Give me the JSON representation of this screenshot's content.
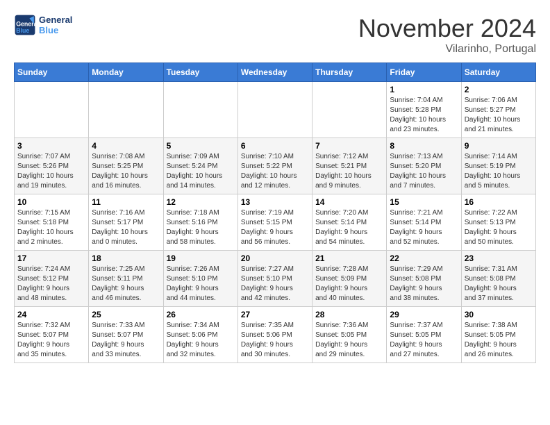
{
  "logo": {
    "general": "General",
    "blue": "Blue"
  },
  "title": "November 2024",
  "location": "Vilarinho, Portugal",
  "weekdays": [
    "Sunday",
    "Monday",
    "Tuesday",
    "Wednesday",
    "Thursday",
    "Friday",
    "Saturday"
  ],
  "weeks": [
    [
      {
        "day": "",
        "info": ""
      },
      {
        "day": "",
        "info": ""
      },
      {
        "day": "",
        "info": ""
      },
      {
        "day": "",
        "info": ""
      },
      {
        "day": "",
        "info": ""
      },
      {
        "day": "1",
        "info": "Sunrise: 7:04 AM\nSunset: 5:28 PM\nDaylight: 10 hours\nand 23 minutes."
      },
      {
        "day": "2",
        "info": "Sunrise: 7:06 AM\nSunset: 5:27 PM\nDaylight: 10 hours\nand 21 minutes."
      }
    ],
    [
      {
        "day": "3",
        "info": "Sunrise: 7:07 AM\nSunset: 5:26 PM\nDaylight: 10 hours\nand 19 minutes."
      },
      {
        "day": "4",
        "info": "Sunrise: 7:08 AM\nSunset: 5:25 PM\nDaylight: 10 hours\nand 16 minutes."
      },
      {
        "day": "5",
        "info": "Sunrise: 7:09 AM\nSunset: 5:24 PM\nDaylight: 10 hours\nand 14 minutes."
      },
      {
        "day": "6",
        "info": "Sunrise: 7:10 AM\nSunset: 5:22 PM\nDaylight: 10 hours\nand 12 minutes."
      },
      {
        "day": "7",
        "info": "Sunrise: 7:12 AM\nSunset: 5:21 PM\nDaylight: 10 hours\nand 9 minutes."
      },
      {
        "day": "8",
        "info": "Sunrise: 7:13 AM\nSunset: 5:20 PM\nDaylight: 10 hours\nand 7 minutes."
      },
      {
        "day": "9",
        "info": "Sunrise: 7:14 AM\nSunset: 5:19 PM\nDaylight: 10 hours\nand 5 minutes."
      }
    ],
    [
      {
        "day": "10",
        "info": "Sunrise: 7:15 AM\nSunset: 5:18 PM\nDaylight: 10 hours\nand 2 minutes."
      },
      {
        "day": "11",
        "info": "Sunrise: 7:16 AM\nSunset: 5:17 PM\nDaylight: 10 hours\nand 0 minutes."
      },
      {
        "day": "12",
        "info": "Sunrise: 7:18 AM\nSunset: 5:16 PM\nDaylight: 9 hours\nand 58 minutes."
      },
      {
        "day": "13",
        "info": "Sunrise: 7:19 AM\nSunset: 5:15 PM\nDaylight: 9 hours\nand 56 minutes."
      },
      {
        "day": "14",
        "info": "Sunrise: 7:20 AM\nSunset: 5:14 PM\nDaylight: 9 hours\nand 54 minutes."
      },
      {
        "day": "15",
        "info": "Sunrise: 7:21 AM\nSunset: 5:14 PM\nDaylight: 9 hours\nand 52 minutes."
      },
      {
        "day": "16",
        "info": "Sunrise: 7:22 AM\nSunset: 5:13 PM\nDaylight: 9 hours\nand 50 minutes."
      }
    ],
    [
      {
        "day": "17",
        "info": "Sunrise: 7:24 AM\nSunset: 5:12 PM\nDaylight: 9 hours\nand 48 minutes."
      },
      {
        "day": "18",
        "info": "Sunrise: 7:25 AM\nSunset: 5:11 PM\nDaylight: 9 hours\nand 46 minutes."
      },
      {
        "day": "19",
        "info": "Sunrise: 7:26 AM\nSunset: 5:10 PM\nDaylight: 9 hours\nand 44 minutes."
      },
      {
        "day": "20",
        "info": "Sunrise: 7:27 AM\nSunset: 5:10 PM\nDaylight: 9 hours\nand 42 minutes."
      },
      {
        "day": "21",
        "info": "Sunrise: 7:28 AM\nSunset: 5:09 PM\nDaylight: 9 hours\nand 40 minutes."
      },
      {
        "day": "22",
        "info": "Sunrise: 7:29 AM\nSunset: 5:08 PM\nDaylight: 9 hours\nand 38 minutes."
      },
      {
        "day": "23",
        "info": "Sunrise: 7:31 AM\nSunset: 5:08 PM\nDaylight: 9 hours\nand 37 minutes."
      }
    ],
    [
      {
        "day": "24",
        "info": "Sunrise: 7:32 AM\nSunset: 5:07 PM\nDaylight: 9 hours\nand 35 minutes."
      },
      {
        "day": "25",
        "info": "Sunrise: 7:33 AM\nSunset: 5:07 PM\nDaylight: 9 hours\nand 33 minutes."
      },
      {
        "day": "26",
        "info": "Sunrise: 7:34 AM\nSunset: 5:06 PM\nDaylight: 9 hours\nand 32 minutes."
      },
      {
        "day": "27",
        "info": "Sunrise: 7:35 AM\nSunset: 5:06 PM\nDaylight: 9 hours\nand 30 minutes."
      },
      {
        "day": "28",
        "info": "Sunrise: 7:36 AM\nSunset: 5:05 PM\nDaylight: 9 hours\nand 29 minutes."
      },
      {
        "day": "29",
        "info": "Sunrise: 7:37 AM\nSunset: 5:05 PM\nDaylight: 9 hours\nand 27 minutes."
      },
      {
        "day": "30",
        "info": "Sunrise: 7:38 AM\nSunset: 5:05 PM\nDaylight: 9 hours\nand 26 minutes."
      }
    ]
  ]
}
